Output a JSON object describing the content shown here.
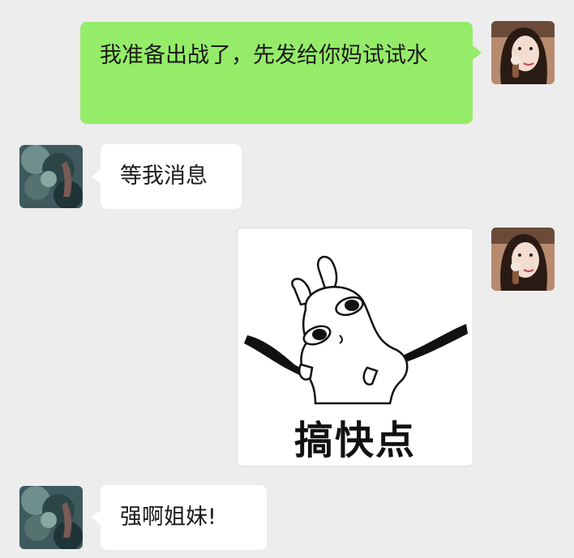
{
  "messages": [
    {
      "side": "right",
      "text": "我准备出战了，先发给你妈试试水"
    },
    {
      "side": "left",
      "text": "等我消息"
    },
    {
      "side": "right",
      "sticker_caption": "搞快点"
    },
    {
      "side": "left",
      "text": "强啊姐妹!"
    }
  ],
  "avatars": {
    "right_icon": "girl-photo-avatar-icon",
    "left_icon": "blue-scenery-avatar-icon"
  },
  "colors": {
    "background": "#ededed",
    "sent_bubble": "#95ec69",
    "received_bubble": "#ffffff"
  }
}
